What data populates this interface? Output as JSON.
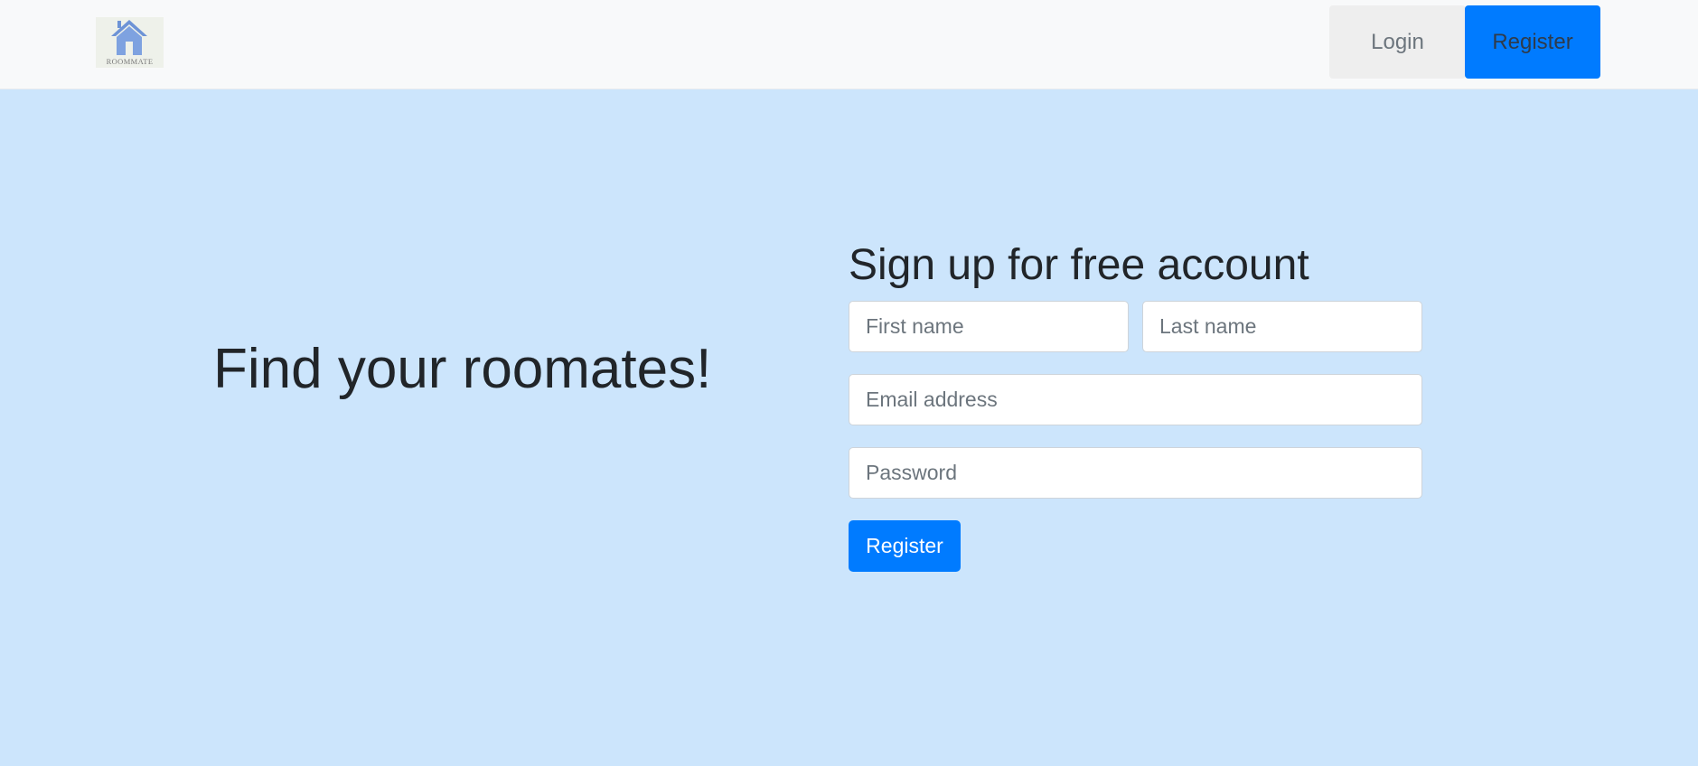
{
  "app": {
    "title": "ROOMMATE",
    "logo_icon": "house-logo-icon"
  },
  "navbar": {
    "login_label": "Login",
    "register_label": "Register"
  },
  "hero": {
    "headline": "Find your roomates!"
  },
  "signup_form": {
    "title": "Sign up for free account",
    "first_name": {
      "placeholder": "First name",
      "value": ""
    },
    "last_name": {
      "placeholder": "Last name",
      "value": ""
    },
    "email": {
      "placeholder": "Email address",
      "value": ""
    },
    "password": {
      "placeholder": "Password",
      "value": ""
    },
    "submit_label": "Register"
  },
  "colors": {
    "page_background": "#cce5fc",
    "navbar_background": "#f8f9fa",
    "primary": "#007bff",
    "text": "#212529"
  }
}
